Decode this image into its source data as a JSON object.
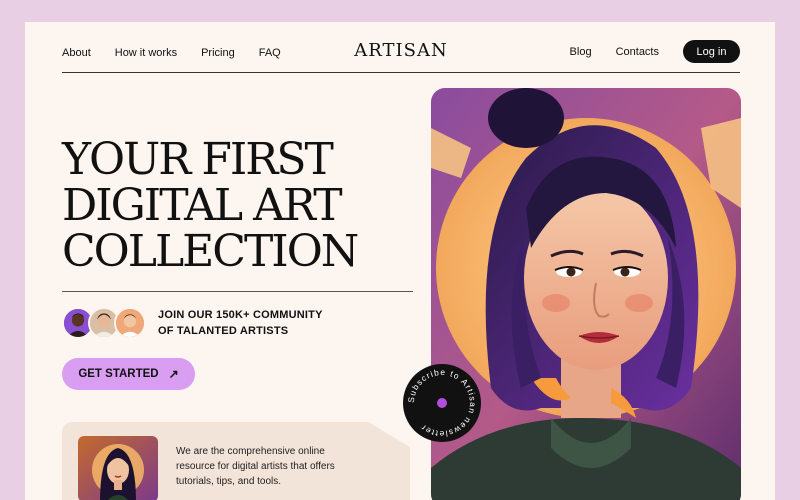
{
  "nav": {
    "links": [
      "About",
      "How it works",
      "Pricing",
      "FAQ"
    ],
    "logo": "ARTISAN",
    "right_links": [
      "Blog",
      "Contacts"
    ],
    "login_label": "Log in"
  },
  "hero": {
    "title_lines": [
      "YOUR FIRST",
      "DIGITAL ART",
      "COLLECTION"
    ]
  },
  "community": {
    "line1": "JOIN OUR 150K+ COMMUNITY",
    "line2": "OF TALANTED ARTISTS"
  },
  "cta": {
    "label": "GET STARTED",
    "icon": "arrow-up-right-icon"
  },
  "info": {
    "text": "We are the comprehensive online resource for digital artists that offers tutorials, tips, and tools."
  },
  "badge": {
    "text": "Subscribe to Artisan newsletter",
    "dot_color": "#b14ee0"
  },
  "colors": {
    "outer_bg": "#e8cfe3",
    "page_bg": "#fcf5f0",
    "accent": "#d99ef2",
    "card_bg": "#f3e4d9",
    "dark": "#111111"
  }
}
